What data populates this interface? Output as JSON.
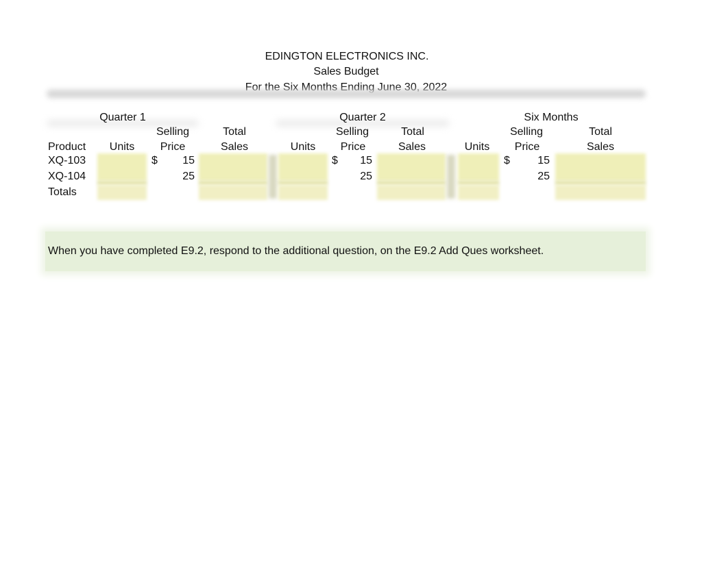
{
  "header": {
    "company": "EDINGTON ELECTRONICS INC.",
    "report_title": "Sales Budget",
    "period": "For the Six Months Ending June 30, 2022"
  },
  "table": {
    "groups": [
      {
        "label": "Quarter 1",
        "columns": {
          "units": "Units",
          "price_top": "Selling",
          "price_bottom": "Price",
          "sales_top": "Total",
          "sales_bottom": "Sales"
        }
      },
      {
        "label": "Quarter 2",
        "columns": {
          "units": "Units",
          "price_top": "Selling",
          "price_bottom": "Price",
          "sales_top": "Total",
          "sales_bottom": "Sales"
        }
      },
      {
        "label": "Six Months",
        "columns": {
          "units": "Units",
          "price_top": "Selling",
          "price_bottom": "Price",
          "sales_top": "Total",
          "sales_bottom": "Sales"
        }
      }
    ],
    "product_header": "Product",
    "currency_symbol": "$",
    "rows": [
      {
        "product": "XQ-103",
        "price": "15",
        "show_currency": true
      },
      {
        "product": "XQ-104",
        "price": "25",
        "show_currency": false
      }
    ],
    "totals_label": "Totals"
  },
  "note": {
    "text": "When you have completed E9.2, respond to the additional question, on the E9.2 Add Ques worksheet."
  },
  "colors": {
    "input_cell": "#efefb8",
    "note_background": "#e6f0da"
  }
}
